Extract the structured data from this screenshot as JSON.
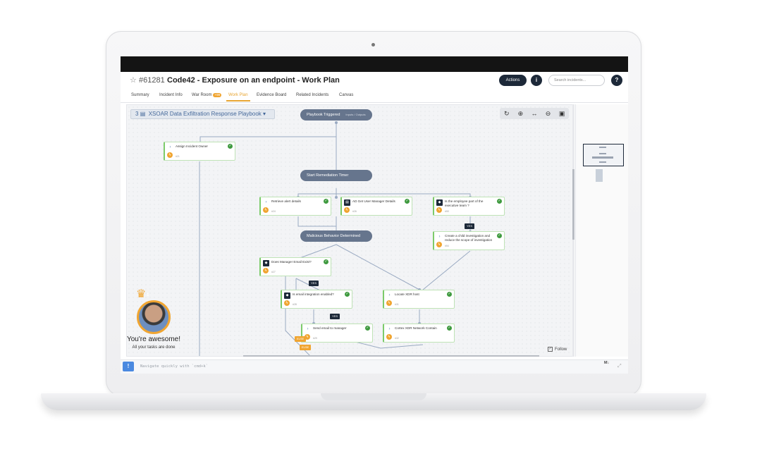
{
  "header": {
    "incident_id": "#61281",
    "title": "Code42 - Exposure on an endpoint - Work Plan",
    "actions_label": "Actions",
    "info_label": "i",
    "help_label": "?",
    "search_placeholder": "Search incidents..."
  },
  "tabs": [
    {
      "label": "Summary"
    },
    {
      "label": "Incident Info"
    },
    {
      "label": "War Room",
      "badge": "+99"
    },
    {
      "label": "Work Plan"
    },
    {
      "label": "Evidence Board"
    },
    {
      "label": "Related Incidents"
    },
    {
      "label": "Canvas"
    }
  ],
  "active_tab": "Work Plan",
  "playbook": {
    "count": "3",
    "name": "XSOAR Data Exfiltration Response Playbook"
  },
  "toolbar_icons": [
    "refresh-icon",
    "zoom-in-icon",
    "fit-width-icon",
    "zoom-out-icon",
    "image-icon"
  ],
  "nodes": {
    "playbook_triggered": {
      "label": "Playbook Triggered",
      "sub": "Inputs / Outputs"
    },
    "start_timer": {
      "label": "Start Remediation Timer"
    },
    "malicious": {
      "label": "Malicious Behavior Determined"
    }
  },
  "tasks": {
    "assign_owner": {
      "name": "Assign Incident Owner",
      "sub": "#21"
    },
    "retrieve_alert": {
      "name": "Retrieve alert details",
      "sub": "#24"
    },
    "get_manager": {
      "name": "AD Get User Manager Details",
      "sub": "#26"
    },
    "exec_team": {
      "name": "Is the employee part of the executive team ?",
      "sub": "#50"
    },
    "child_investigation": {
      "name": "Create a child investigation and reduce the scope of investigation",
      "sub": "#54"
    },
    "manager_email": {
      "name": "Does Manager Email Exist?",
      "sub": "#27"
    },
    "email_integration": {
      "name": "Is email integration enabled?",
      "sub": "#28"
    },
    "locate_host": {
      "name": "Locate XDR host",
      "sub": "#31"
    },
    "send_email": {
      "name": "Send email to manager",
      "sub": "#29"
    },
    "network_contain": {
      "name": "Cortex XDR Network Contain",
      "sub": "#32"
    }
  },
  "conditions": {
    "yes1": "YES",
    "yes2": "YES",
    "yes3": "YES",
    "else1": "ELSE",
    "else2": "ELSE"
  },
  "profile": {
    "rank": "1",
    "message": "You're awesome!",
    "sub_message": "All your tasks are done"
  },
  "follow_label": "Follow",
  "command": {
    "icon_label": "!",
    "placeholder": "Navigate quickly with `cmd+k`",
    "md_label": "M↓"
  },
  "colors": {
    "accent": "#f0a531",
    "dark": "#1d2939",
    "node": "#66758d",
    "success": "#3f9a3f",
    "link": "#44689a"
  }
}
